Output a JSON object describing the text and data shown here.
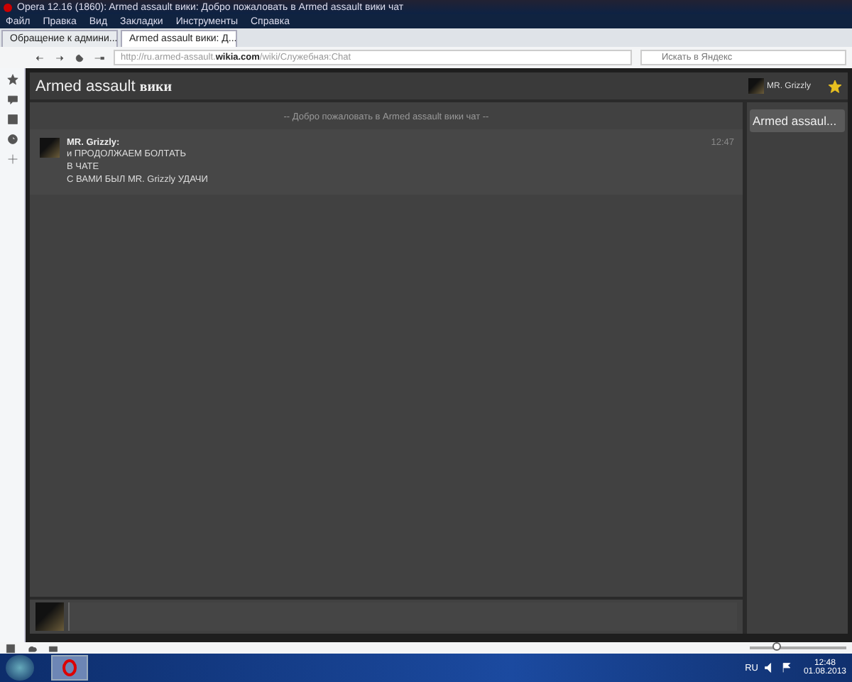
{
  "window": {
    "title": "Opera 12.16 (1860): Armed assault вики: Добро пожаловать в Armed assault вики чат"
  },
  "menu": [
    "Файл",
    "Правка",
    "Вид",
    "Закладки",
    "Инструменты",
    "Справка"
  ],
  "tabs": [
    {
      "label": "Обращение к админи...",
      "selected": false
    },
    {
      "label": "Armed assault вики: Д...",
      "selected": true
    }
  ],
  "address": {
    "prefix": "http://ru.armed-assault.",
    "domain": "wikia.com",
    "path": "/wiki/Служебная:Chat"
  },
  "search": {
    "placeholder": "Искать в Яндекс"
  },
  "chat": {
    "title": "Armed assault",
    "title_suffix": "вики",
    "current_user": "MR. Grizzly",
    "welcome": "-- Добро пожаловать в Armed assault вики чат --",
    "messages": [
      {
        "author": "MR. Grizzly:",
        "time": "12:47",
        "lines": [
          "и ПРОДОЛЖАЕМ БОЛТАТЬ",
          "В ЧАТЕ",
          "С ВАМИ БЫЛ MR. Grizzly УДАЧИ"
        ]
      }
    ],
    "room": "Armed assaul..."
  },
  "status_bar": {
    "zoom": {
      "level": 0.28
    }
  },
  "taskbar": {
    "language": "RU",
    "time": "12:48",
    "date": "01.08.2013"
  }
}
